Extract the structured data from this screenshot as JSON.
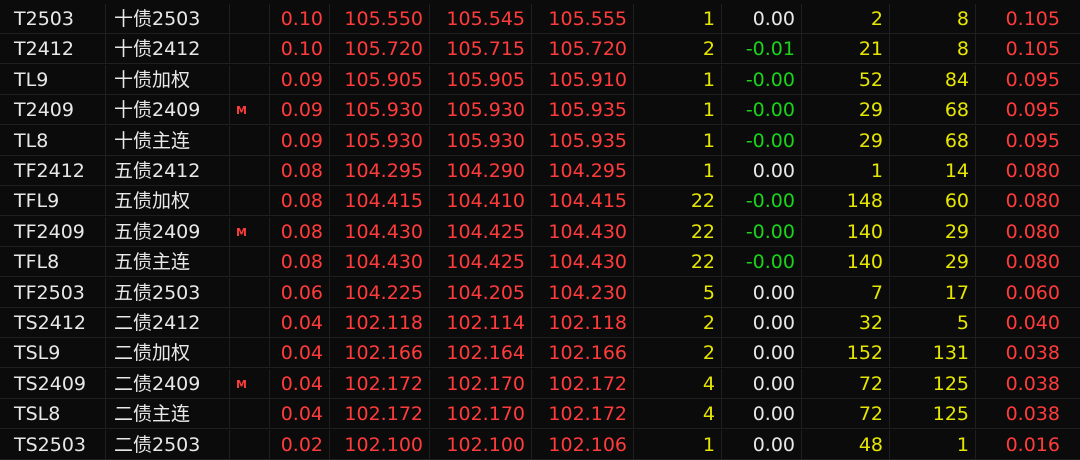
{
  "colors": {
    "background": "#0b0b0b",
    "red": "#ff3b3b",
    "green": "#19d419",
    "yellow": "#e6e600",
    "white": "#e8e8e8"
  },
  "rows": [
    {
      "code": "T2503",
      "name": "十债2503",
      "flag": "",
      "chg": "0.10",
      "last": "105.550",
      "bid": "105.545",
      "ask": "105.555",
      "vol": "1",
      "diff": "0.00",
      "bid_vol": "2",
      "ask_vol": "8",
      "pct": "0.105"
    },
    {
      "code": "T2412",
      "name": "十债2412",
      "flag": "",
      "chg": "0.10",
      "last": "105.720",
      "bid": "105.715",
      "ask": "105.720",
      "vol": "2",
      "diff": "-0.01",
      "bid_vol": "21",
      "ask_vol": "8",
      "pct": "0.105"
    },
    {
      "code": "TL9",
      "name": "十债加权",
      "flag": "",
      "chg": "0.09",
      "last": "105.905",
      "bid": "105.905",
      "ask": "105.910",
      "vol": "1",
      "diff": "-0.00",
      "bid_vol": "52",
      "ask_vol": "84",
      "pct": "0.095"
    },
    {
      "code": "T2409",
      "name": "十债2409",
      "flag": "M",
      "chg": "0.09",
      "last": "105.930",
      "bid": "105.930",
      "ask": "105.935",
      "vol": "1",
      "diff": "-0.00",
      "bid_vol": "29",
      "ask_vol": "68",
      "pct": "0.095"
    },
    {
      "code": "TL8",
      "name": "十债主连",
      "flag": "",
      "chg": "0.09",
      "last": "105.930",
      "bid": "105.930",
      "ask": "105.935",
      "vol": "1",
      "diff": "-0.00",
      "bid_vol": "29",
      "ask_vol": "68",
      "pct": "0.095"
    },
    {
      "code": "TF2412",
      "name": "五债2412",
      "flag": "",
      "chg": "0.08",
      "last": "104.295",
      "bid": "104.290",
      "ask": "104.295",
      "vol": "1",
      "diff": "0.00",
      "bid_vol": "1",
      "ask_vol": "14",
      "pct": "0.080"
    },
    {
      "code": "TFL9",
      "name": "五债加权",
      "flag": "",
      "chg": "0.08",
      "last": "104.415",
      "bid": "104.410",
      "ask": "104.415",
      "vol": "22",
      "diff": "-0.00",
      "bid_vol": "148",
      "ask_vol": "60",
      "pct": "0.080"
    },
    {
      "code": "TF2409",
      "name": "五债2409",
      "flag": "M",
      "chg": "0.08",
      "last": "104.430",
      "bid": "104.425",
      "ask": "104.430",
      "vol": "22",
      "diff": "-0.00",
      "bid_vol": "140",
      "ask_vol": "29",
      "pct": "0.080"
    },
    {
      "code": "TFL8",
      "name": "五债主连",
      "flag": "",
      "chg": "0.08",
      "last": "104.430",
      "bid": "104.425",
      "ask": "104.430",
      "vol": "22",
      "diff": "-0.00",
      "bid_vol": "140",
      "ask_vol": "29",
      "pct": "0.080"
    },
    {
      "code": "TF2503",
      "name": "五债2503",
      "flag": "",
      "chg": "0.06",
      "last": "104.225",
      "bid": "104.205",
      "ask": "104.230",
      "vol": "5",
      "diff": "0.00",
      "bid_vol": "7",
      "ask_vol": "17",
      "pct": "0.060"
    },
    {
      "code": "TS2412",
      "name": "二债2412",
      "flag": "",
      "chg": "0.04",
      "last": "102.118",
      "bid": "102.114",
      "ask": "102.118",
      "vol": "2",
      "diff": "0.00",
      "bid_vol": "32",
      "ask_vol": "5",
      "pct": "0.040"
    },
    {
      "code": "TSL9",
      "name": "二债加权",
      "flag": "",
      "chg": "0.04",
      "last": "102.166",
      "bid": "102.164",
      "ask": "102.166",
      "vol": "2",
      "diff": "0.00",
      "bid_vol": "152",
      "ask_vol": "131",
      "pct": "0.038"
    },
    {
      "code": "TS2409",
      "name": "二债2409",
      "flag": "M",
      "chg": "0.04",
      "last": "102.172",
      "bid": "102.170",
      "ask": "102.172",
      "vol": "4",
      "diff": "0.00",
      "bid_vol": "72",
      "ask_vol": "125",
      "pct": "0.038"
    },
    {
      "code": "TSL8",
      "name": "二债主连",
      "flag": "",
      "chg": "0.04",
      "last": "102.172",
      "bid": "102.170",
      "ask": "102.172",
      "vol": "4",
      "diff": "0.00",
      "bid_vol": "72",
      "ask_vol": "125",
      "pct": "0.038"
    },
    {
      "code": "TS2503",
      "name": "二债2503",
      "flag": "",
      "chg": "0.02",
      "last": "102.100",
      "bid": "102.100",
      "ask": "102.106",
      "vol": "1",
      "diff": "0.00",
      "bid_vol": "48",
      "ask_vol": "1",
      "pct": "0.016"
    }
  ]
}
